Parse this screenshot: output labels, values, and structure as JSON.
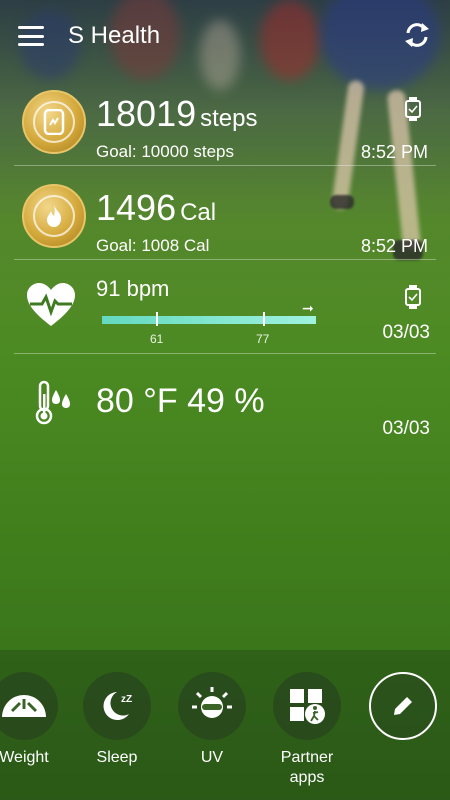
{
  "header": {
    "title": "S Health",
    "menu_icon": "hamburger-menu-icon",
    "refresh_icon": "sync-icon"
  },
  "steps": {
    "value": "18019",
    "unit": "steps",
    "goal": "Goal: 10000 steps",
    "time": "8:52 PM",
    "icon": "steps-medal-icon"
  },
  "calories": {
    "value": "1496",
    "unit": "Cal",
    "goal": "Goal: 1008 Cal",
    "time": "8:52 PM",
    "icon": "flame-medal-icon"
  },
  "heart_rate": {
    "value": "91 bpm",
    "low_tick": "61",
    "high_tick": "77",
    "date": "03/03",
    "icon": "heart-rate-icon"
  },
  "environment": {
    "value": "80 °F 49 %",
    "date": "03/03",
    "icon": "thermo-hygrometer-icon"
  },
  "shortcuts": [
    {
      "label": "Weight",
      "icon": "scale-icon"
    },
    {
      "label": "Sleep",
      "icon": "moon-sleep-icon"
    },
    {
      "label": "UV",
      "icon": "uv-sun-icon"
    },
    {
      "label": "Partner apps",
      "icon": "partner-apps-icon"
    }
  ],
  "colors": {
    "accent_medal": "#d4a93b",
    "hr_bar": "#64d9c0"
  }
}
